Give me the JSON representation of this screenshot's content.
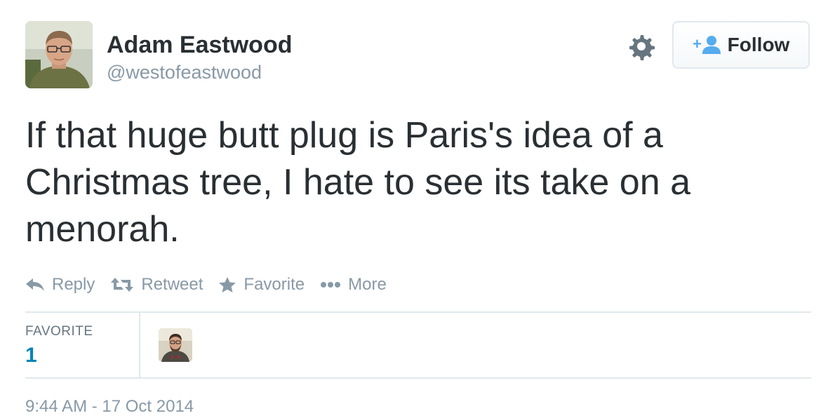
{
  "user": {
    "name": "Adam Eastwood",
    "handle": "@westofeastwood"
  },
  "follow_button": {
    "label": "Follow"
  },
  "tweet": {
    "text": "If that huge butt plug is Paris's idea of a Christmas tree, I hate to see its take on a menorah."
  },
  "actions": {
    "reply": "Reply",
    "retweet": "Retweet",
    "favorite": "Favorite",
    "more": "More"
  },
  "stats": {
    "favorites_label": "FAVORITE",
    "favorites_count": "1"
  },
  "timestamp": "9:44 AM - 17 Oct 2014",
  "colors": {
    "text": "#292f33",
    "muted": "#8899a6",
    "link": "#0084b4",
    "follow_icon": "#55acee",
    "border": "#e1e8ed"
  }
}
